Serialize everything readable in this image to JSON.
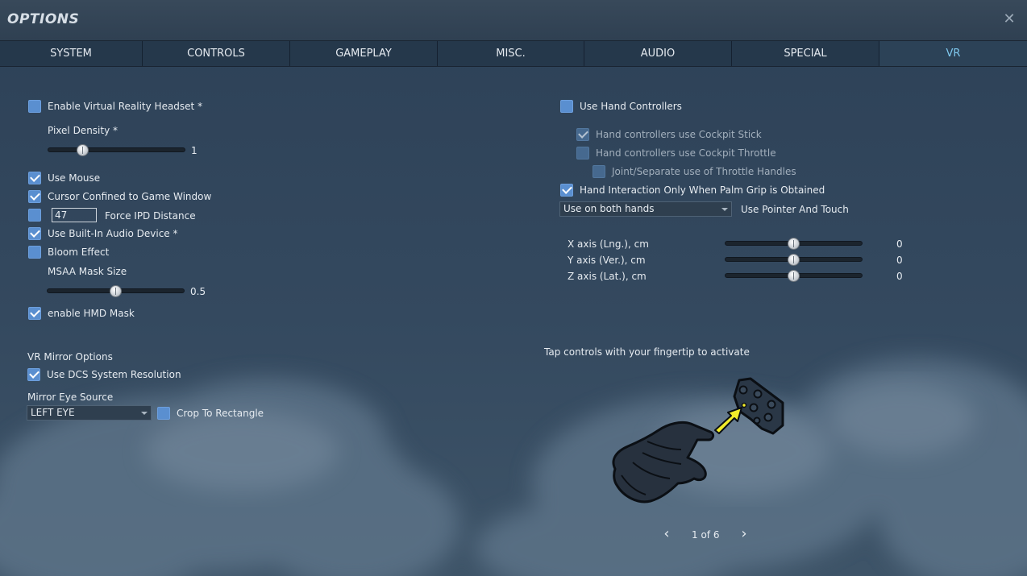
{
  "window": {
    "title": "OPTIONS",
    "close_icon": "close-icon"
  },
  "tabs": [
    {
      "label": "SYSTEM",
      "active": false
    },
    {
      "label": "CONTROLS",
      "active": false
    },
    {
      "label": "GAMEPLAY",
      "active": false
    },
    {
      "label": "MISC.",
      "active": false
    },
    {
      "label": "AUDIO",
      "active": false
    },
    {
      "label": "SPECIAL",
      "active": false
    },
    {
      "label": "VR",
      "active": true
    }
  ],
  "left": {
    "enable_vr": {
      "label": "Enable Virtual Reality Headset *",
      "checked": false
    },
    "pixel_density": {
      "label": "Pixel Density *",
      "value": "1",
      "fraction": 0.26
    },
    "use_mouse": {
      "label": "Use Mouse",
      "checked": true
    },
    "cursor_confined": {
      "label": "Cursor Confined to Game Window",
      "checked": true
    },
    "force_ipd": {
      "label": "Force IPD Distance",
      "value": "47",
      "checked": false
    },
    "builtin_audio": {
      "label": "Use Built-In Audio Device *",
      "checked": true
    },
    "bloom": {
      "label": "Bloom Effect",
      "checked": false
    },
    "msaa_mask": {
      "label": "MSAA Mask Size",
      "value": "0.5",
      "fraction": 0.5
    },
    "hmd_mask": {
      "label": "enable HMD Mask",
      "checked": true
    },
    "mirror_options": {
      "heading": "VR Mirror Options"
    },
    "dcs_resolution": {
      "label": "Use DCS System Resolution",
      "checked": true
    },
    "mirror_eye": {
      "label": "Mirror Eye Source",
      "selected": "LEFT EYE"
    },
    "crop_rect": {
      "label": "Crop To Rectangle",
      "checked": false
    }
  },
  "right": {
    "hand_controllers": {
      "label": "Use Hand Controllers",
      "checked": false
    },
    "cockpit_stick": {
      "label": "Hand controllers use Cockpit Stick",
      "checked": true,
      "disabled": true
    },
    "cockpit_throttle": {
      "label": "Hand controllers use Cockpit Throttle",
      "checked": false,
      "disabled": true
    },
    "throttle_handles": {
      "label": "Joint/Separate use of Throttle Handles",
      "checked": false,
      "disabled": true
    },
    "palm_grip": {
      "label": "Hand Interaction Only When Palm Grip is Obtained",
      "checked": true
    },
    "hands_select": {
      "selected": "Use on both hands",
      "label": "Use Pointer And Touch"
    },
    "axes": [
      {
        "label": "X axis (Lng.), cm",
        "value": "0",
        "fraction": 0.5
      },
      {
        "label": "Y axis (Ver.), cm",
        "value": "0",
        "fraction": 0.5
      },
      {
        "label": "Z axis (Lat.), cm",
        "value": "0",
        "fraction": 0.5
      }
    ],
    "hint": "Tap controls with your fingertip to activate",
    "illustration_icon": "gloved-hand-touch-panel-icon",
    "pager": {
      "text": "1 of 6",
      "prev_icon": "chevron-left-icon",
      "next_icon": "chevron-right-icon"
    }
  },
  "colors": {
    "checkbox": "#5a8fd0",
    "active_tab": "#7fc8ee",
    "background": "#34495f"
  }
}
